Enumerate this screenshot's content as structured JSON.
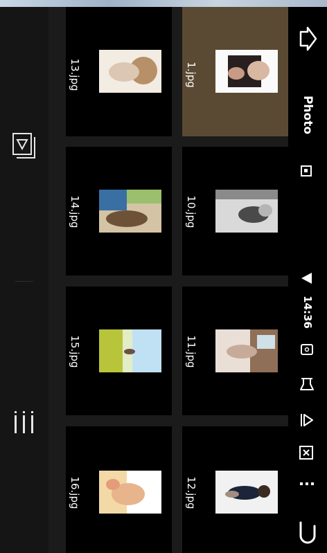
{
  "status_bar": {
    "time": "14:36"
  },
  "header": {
    "title": "Photo"
  },
  "files": [
    {
      "name": "1.jpg",
      "selected": true,
      "colors": [
        "#fafafa",
        "#2a1f1f",
        "#d8b7a3"
      ]
    },
    {
      "name": "10.jpg",
      "selected": false,
      "colors": [
        "#d9d9d9",
        "#4a4a4a",
        "#b5b5b5"
      ]
    },
    {
      "name": "11.jpg",
      "selected": false,
      "colors": [
        "#e9dfd6",
        "#8f6f57",
        "#c7ab99"
      ]
    },
    {
      "name": "12.jpg",
      "selected": false,
      "colors": [
        "#f1f1f1",
        "#1b2438",
        "#a28d80"
      ]
    },
    {
      "name": "13.jpg",
      "selected": false,
      "colors": [
        "#f3ece3",
        "#b79068",
        "#dcc7b2"
      ]
    },
    {
      "name": "14.jpg",
      "selected": false,
      "colors": [
        "#3a6fa3",
        "#6e5238",
        "#d4c3a5"
      ]
    },
    {
      "name": "15.jpg",
      "selected": false,
      "colors": [
        "#bfe1f3",
        "#b8c43a",
        "#e2ecc5"
      ]
    },
    {
      "name": "16.jpg",
      "selected": false,
      "colors": [
        "#f2d9a6",
        "#e7b48b",
        "#ffffff"
      ]
    }
  ],
  "icons": {
    "exit": "exit-arrow-icon",
    "photo_small": "image-icon",
    "triangle": "sound-triangle-icon",
    "info": "info-icon",
    "flask": "flask-icon",
    "play": "play-icon",
    "close": "close-box-icon",
    "more": "more-dots-icon",
    "back": "back-u-icon",
    "select": "select-box-icon",
    "menu": "menu-bars-icon"
  }
}
